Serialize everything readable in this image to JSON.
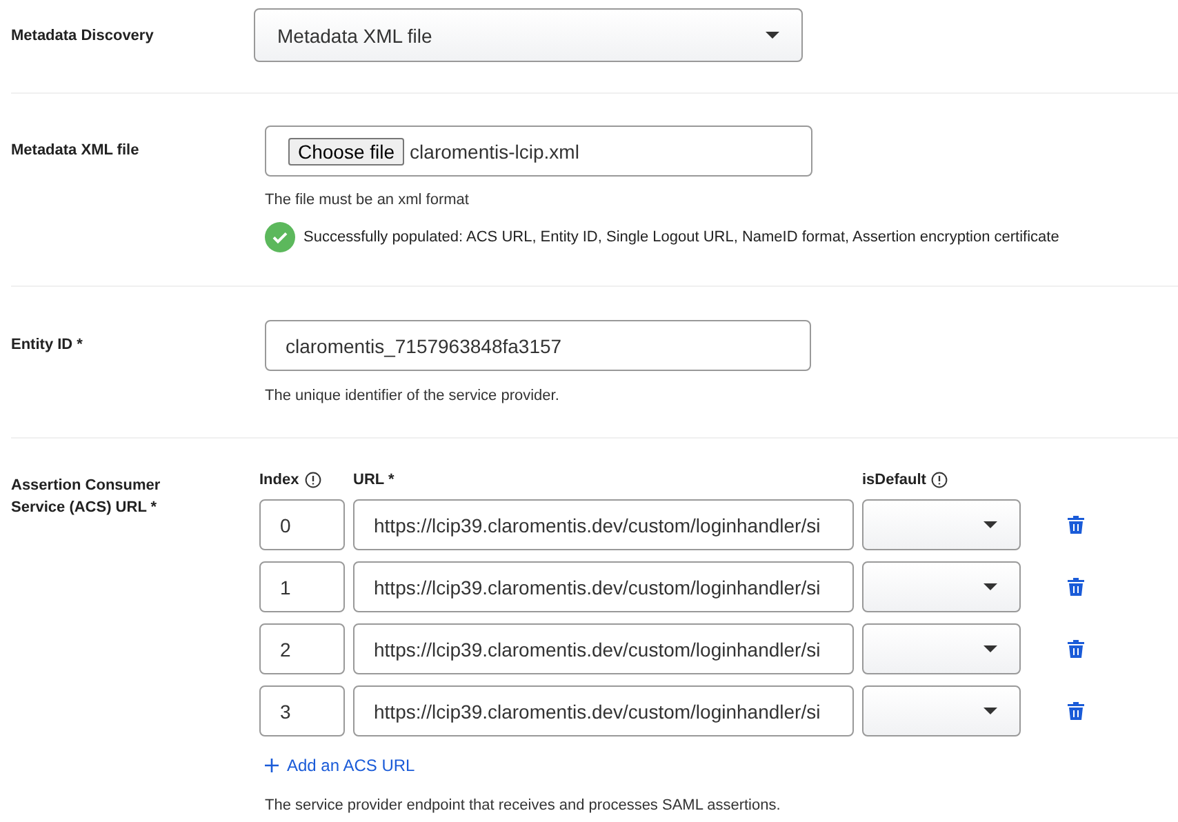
{
  "metadata_discovery": {
    "label": "Metadata Discovery",
    "value": "Metadata XML file"
  },
  "metadata_file": {
    "label": "Metadata XML file",
    "button": "Choose file",
    "filename": "claromentis-lcip.xml",
    "hint": "The file must be an xml format",
    "success": "Successfully populated: ACS URL, Entity ID, Single Logout URL, NameID format, Assertion encryption certificate"
  },
  "entity_id": {
    "label": "Entity ID *",
    "value": "claromentis_7157963848fa3157",
    "hint": "The unique identifier of the service provider."
  },
  "acs": {
    "label": "Assertion Consumer Service (ACS) URL *",
    "columns": [
      {
        "label": "Index",
        "info": true
      },
      {
        "label": "URL *",
        "info": false
      },
      {
        "label": "isDefault",
        "info": true
      }
    ],
    "rows": [
      {
        "index": "0",
        "url": "https://lcip39.claromentis.dev/custom/loginhandler/si"
      },
      {
        "index": "1",
        "url": "https://lcip39.claromentis.dev/custom/loginhandler/si"
      },
      {
        "index": "2",
        "url": "https://lcip39.claromentis.dev/custom/loginhandler/si"
      },
      {
        "index": "3",
        "url": "https://lcip39.claromentis.dev/custom/loginhandler/si"
      }
    ],
    "add": "Add an ACS URL",
    "hint": "The service provider endpoint that receives and processes SAML assertions."
  }
}
